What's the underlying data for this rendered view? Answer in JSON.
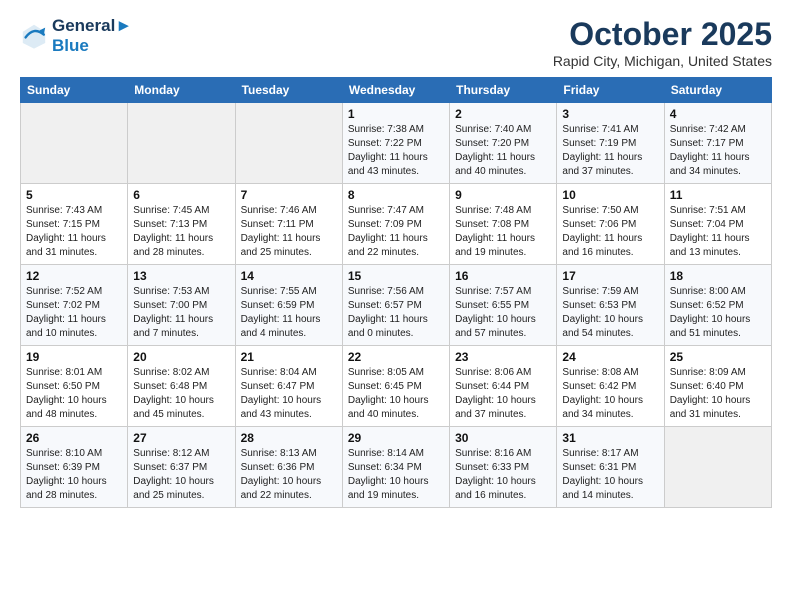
{
  "header": {
    "logo_line1": "General",
    "logo_line2": "Blue",
    "month_title": "October 2025",
    "subtitle": "Rapid City, Michigan, United States"
  },
  "days_of_week": [
    "Sunday",
    "Monday",
    "Tuesday",
    "Wednesday",
    "Thursday",
    "Friday",
    "Saturday"
  ],
  "weeks": [
    [
      {
        "num": "",
        "info": ""
      },
      {
        "num": "",
        "info": ""
      },
      {
        "num": "",
        "info": ""
      },
      {
        "num": "1",
        "info": "Sunrise: 7:38 AM\nSunset: 7:22 PM\nDaylight: 11 hours\nand 43 minutes."
      },
      {
        "num": "2",
        "info": "Sunrise: 7:40 AM\nSunset: 7:20 PM\nDaylight: 11 hours\nand 40 minutes."
      },
      {
        "num": "3",
        "info": "Sunrise: 7:41 AM\nSunset: 7:19 PM\nDaylight: 11 hours\nand 37 minutes."
      },
      {
        "num": "4",
        "info": "Sunrise: 7:42 AM\nSunset: 7:17 PM\nDaylight: 11 hours\nand 34 minutes."
      }
    ],
    [
      {
        "num": "5",
        "info": "Sunrise: 7:43 AM\nSunset: 7:15 PM\nDaylight: 11 hours\nand 31 minutes."
      },
      {
        "num": "6",
        "info": "Sunrise: 7:45 AM\nSunset: 7:13 PM\nDaylight: 11 hours\nand 28 minutes."
      },
      {
        "num": "7",
        "info": "Sunrise: 7:46 AM\nSunset: 7:11 PM\nDaylight: 11 hours\nand 25 minutes."
      },
      {
        "num": "8",
        "info": "Sunrise: 7:47 AM\nSunset: 7:09 PM\nDaylight: 11 hours\nand 22 minutes."
      },
      {
        "num": "9",
        "info": "Sunrise: 7:48 AM\nSunset: 7:08 PM\nDaylight: 11 hours\nand 19 minutes."
      },
      {
        "num": "10",
        "info": "Sunrise: 7:50 AM\nSunset: 7:06 PM\nDaylight: 11 hours\nand 16 minutes."
      },
      {
        "num": "11",
        "info": "Sunrise: 7:51 AM\nSunset: 7:04 PM\nDaylight: 11 hours\nand 13 minutes."
      }
    ],
    [
      {
        "num": "12",
        "info": "Sunrise: 7:52 AM\nSunset: 7:02 PM\nDaylight: 11 hours\nand 10 minutes."
      },
      {
        "num": "13",
        "info": "Sunrise: 7:53 AM\nSunset: 7:00 PM\nDaylight: 11 hours\nand 7 minutes."
      },
      {
        "num": "14",
        "info": "Sunrise: 7:55 AM\nSunset: 6:59 PM\nDaylight: 11 hours\nand 4 minutes."
      },
      {
        "num": "15",
        "info": "Sunrise: 7:56 AM\nSunset: 6:57 PM\nDaylight: 11 hours\nand 0 minutes."
      },
      {
        "num": "16",
        "info": "Sunrise: 7:57 AM\nSunset: 6:55 PM\nDaylight: 10 hours\nand 57 minutes."
      },
      {
        "num": "17",
        "info": "Sunrise: 7:59 AM\nSunset: 6:53 PM\nDaylight: 10 hours\nand 54 minutes."
      },
      {
        "num": "18",
        "info": "Sunrise: 8:00 AM\nSunset: 6:52 PM\nDaylight: 10 hours\nand 51 minutes."
      }
    ],
    [
      {
        "num": "19",
        "info": "Sunrise: 8:01 AM\nSunset: 6:50 PM\nDaylight: 10 hours\nand 48 minutes."
      },
      {
        "num": "20",
        "info": "Sunrise: 8:02 AM\nSunset: 6:48 PM\nDaylight: 10 hours\nand 45 minutes."
      },
      {
        "num": "21",
        "info": "Sunrise: 8:04 AM\nSunset: 6:47 PM\nDaylight: 10 hours\nand 43 minutes."
      },
      {
        "num": "22",
        "info": "Sunrise: 8:05 AM\nSunset: 6:45 PM\nDaylight: 10 hours\nand 40 minutes."
      },
      {
        "num": "23",
        "info": "Sunrise: 8:06 AM\nSunset: 6:44 PM\nDaylight: 10 hours\nand 37 minutes."
      },
      {
        "num": "24",
        "info": "Sunrise: 8:08 AM\nSunset: 6:42 PM\nDaylight: 10 hours\nand 34 minutes."
      },
      {
        "num": "25",
        "info": "Sunrise: 8:09 AM\nSunset: 6:40 PM\nDaylight: 10 hours\nand 31 minutes."
      }
    ],
    [
      {
        "num": "26",
        "info": "Sunrise: 8:10 AM\nSunset: 6:39 PM\nDaylight: 10 hours\nand 28 minutes."
      },
      {
        "num": "27",
        "info": "Sunrise: 8:12 AM\nSunset: 6:37 PM\nDaylight: 10 hours\nand 25 minutes."
      },
      {
        "num": "28",
        "info": "Sunrise: 8:13 AM\nSunset: 6:36 PM\nDaylight: 10 hours\nand 22 minutes."
      },
      {
        "num": "29",
        "info": "Sunrise: 8:14 AM\nSunset: 6:34 PM\nDaylight: 10 hours\nand 19 minutes."
      },
      {
        "num": "30",
        "info": "Sunrise: 8:16 AM\nSunset: 6:33 PM\nDaylight: 10 hours\nand 16 minutes."
      },
      {
        "num": "31",
        "info": "Sunrise: 8:17 AM\nSunset: 6:31 PM\nDaylight: 10 hours\nand 14 minutes."
      },
      {
        "num": "",
        "info": ""
      }
    ]
  ]
}
